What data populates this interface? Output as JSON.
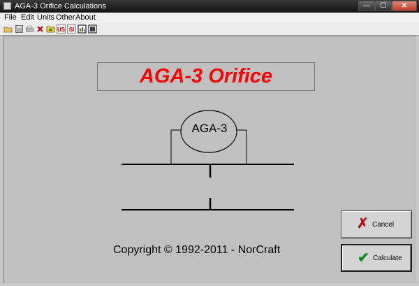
{
  "window": {
    "title": "AGA-3 Orifice Calculations",
    "min_glyph": "—",
    "max_glyph": "☐",
    "close_glyph": "✕"
  },
  "menu": [
    "File",
    "Edit",
    "Units",
    "Other",
    "About"
  ],
  "toolbar": {
    "us_label": "US",
    "si_label": "SI"
  },
  "main": {
    "banner_title": "AGA-3 Orifice",
    "meter_label": "AGA-3",
    "copyright": "Copyright © 1992-2011 -  NorCraft"
  },
  "buttons": {
    "cancel_label": "Cancel",
    "calculate_label": "Calculate"
  },
  "colors": {
    "banner_text": "#ff0000",
    "cancel_icon": "#b01010",
    "calculate_icon": "#109020"
  }
}
